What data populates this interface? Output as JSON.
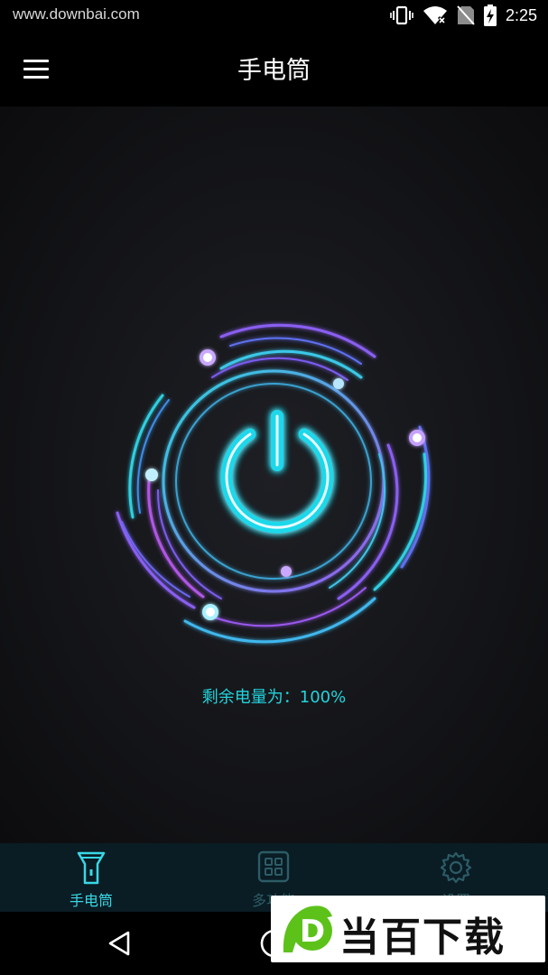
{
  "status_bar": {
    "watermark_url": "www.downbai.com",
    "time": "2:25",
    "icons": [
      "vibrate-icon",
      "wifi-off-icon",
      "no-sim-icon",
      "battery-charging-icon"
    ]
  },
  "app_bar": {
    "menu_icon": "hamburger-menu-icon",
    "title": "手电筒"
  },
  "main": {
    "power_icon": "power-icon",
    "battery_text": "剩余电量为：100%",
    "battery_level_percent": 100
  },
  "bottom_nav": {
    "items": [
      {
        "label": "手电筒",
        "icon": "flashlight-icon",
        "active": true
      },
      {
        "label": "多功能",
        "icon": "grid-icon",
        "active": false
      },
      {
        "label": "设置",
        "icon": "gear-icon",
        "active": false
      }
    ]
  },
  "system_nav": {
    "back_icon": "back-triangle-icon",
    "home_icon": "home-circle-icon"
  },
  "watermark": {
    "logo_letter": "D",
    "logo_text": "当百下载"
  },
  "colors": {
    "accent_cyan": "#22d4dc",
    "accent_purple": "#7a5cf0",
    "accent_magenta": "#b057e6",
    "nav_background": "#0a1c24",
    "logo_green": "#5cc21a"
  }
}
